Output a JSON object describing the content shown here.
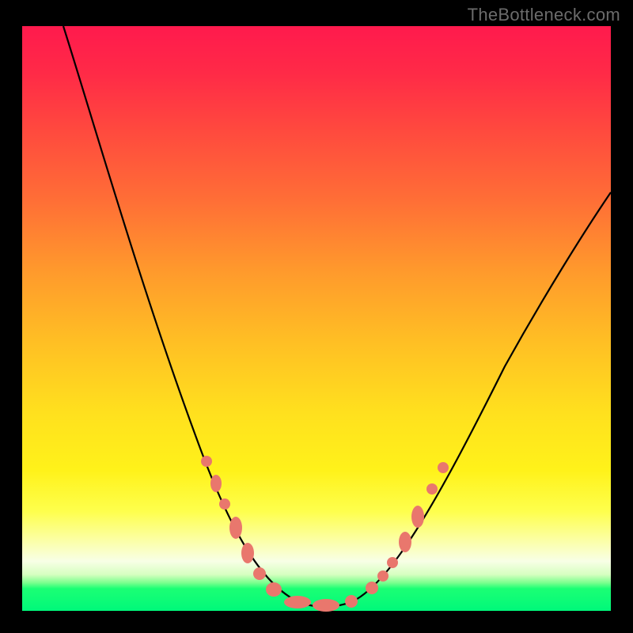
{
  "watermark": "TheBottleneck.com",
  "chart_data": {
    "type": "line",
    "title": "",
    "xlabel": "",
    "ylabel": "",
    "xlim": [
      0,
      100
    ],
    "ylim": [
      0,
      100
    ],
    "series": [
      {
        "name": "bottleneck-curve",
        "x": [
          7,
          10,
          14,
          18,
          22,
          26,
          30,
          33,
          36,
          38,
          40,
          42,
          44,
          46,
          48,
          50,
          52,
          55,
          58,
          62,
          66,
          72,
          80,
          90,
          100
        ],
        "y": [
          100,
          93,
          84,
          74,
          64,
          54,
          43,
          33,
          24,
          17,
          11,
          6,
          3,
          1,
          0,
          0,
          1,
          4,
          9,
          15,
          22,
          30,
          40,
          50,
          58
        ]
      }
    ],
    "markers": [
      {
        "name": "left-cluster",
        "approx_x_range": [
          32,
          46
        ],
        "approx_y_range": [
          2,
          28
        ],
        "color": "#e9776d"
      },
      {
        "name": "right-cluster",
        "approx_x_range": [
          54,
          65
        ],
        "approx_y_range": [
          2,
          24
        ],
        "color": "#e9776d"
      }
    ],
    "colors": {
      "curve": "#000000",
      "marker": "#e9776d",
      "gradient_top": "#ff1a4d",
      "gradient_bottom": "#00f87a"
    }
  }
}
